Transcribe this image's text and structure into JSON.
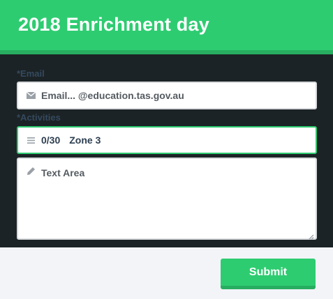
{
  "header": {
    "title": "2018 Enrichment day"
  },
  "form": {
    "email": {
      "label": "*Email",
      "placeholder": "Email... @education.tas.gov.au",
      "icon": "envelope-icon"
    },
    "activities": {
      "label": "*Activities",
      "count": "0/30",
      "value": "Zone 3",
      "icon": "list-icon"
    },
    "notes": {
      "placeholder": "Text Area",
      "icon": "pencil-icon"
    }
  },
  "footer": {
    "submit_label": "Submit"
  },
  "colors": {
    "accent": "#2ecc71",
    "accent_dark": "#27ae60",
    "form_bg": "#1c2326",
    "label": "#34495e"
  }
}
